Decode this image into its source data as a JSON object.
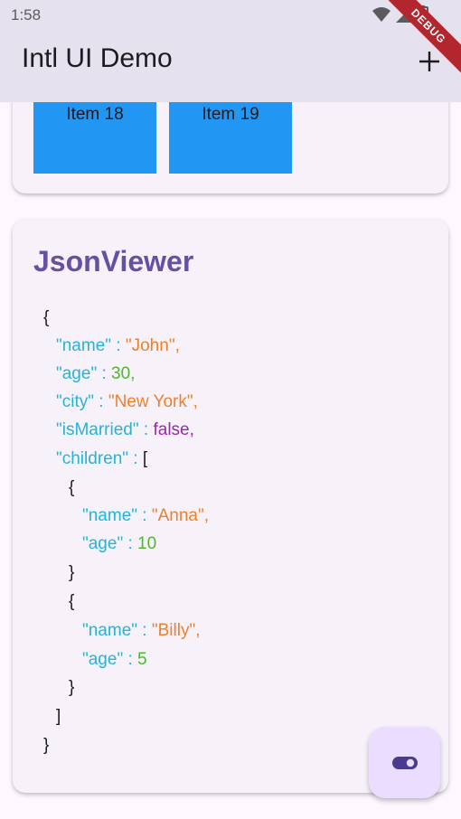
{
  "status_bar": {
    "time": "1:58"
  },
  "app_bar": {
    "title": "Intl UI Demo",
    "action_icon": "plus-icon",
    "debug_label": "DEBUG"
  },
  "grid_items": [
    "Item 18",
    "Item 19"
  ],
  "json_viewer": {
    "title": "JsonViewer",
    "lines": {
      "open": "{",
      "name_k": "\"name\"",
      "name_v": "\"John\",",
      "age_k": "\"age\"",
      "age_v": "30,",
      "city_k": "\"city\"",
      "city_v": "\"New York\",",
      "married_k": "\"isMarried\"",
      "married_v": "false,",
      "children_k": "\"children\"",
      "children_v": "[",
      "c1_open": "{",
      "c1_name_k": "\"name\"",
      "c1_name_v": "\"Anna\",",
      "c1_age_k": "\"age\"",
      "c1_age_v": "10",
      "c1_close": "}",
      "c2_open": "{",
      "c2_name_k": "\"name\"",
      "c2_name_v": "\"Billy\",",
      "c2_age_k": "\"age\"",
      "c2_age_v": "5",
      "c2_close": "}",
      "arr_close": "]",
      "close": "}"
    },
    "sep": " : "
  },
  "fab": {
    "icon": "toggle-icon"
  },
  "colors": {
    "key": "#24b3d9",
    "string": "#ef7f2a",
    "number": "#4db82c",
    "bool": "#9c27b0",
    "accent": "#6750a4",
    "grid": "#2196f3"
  }
}
